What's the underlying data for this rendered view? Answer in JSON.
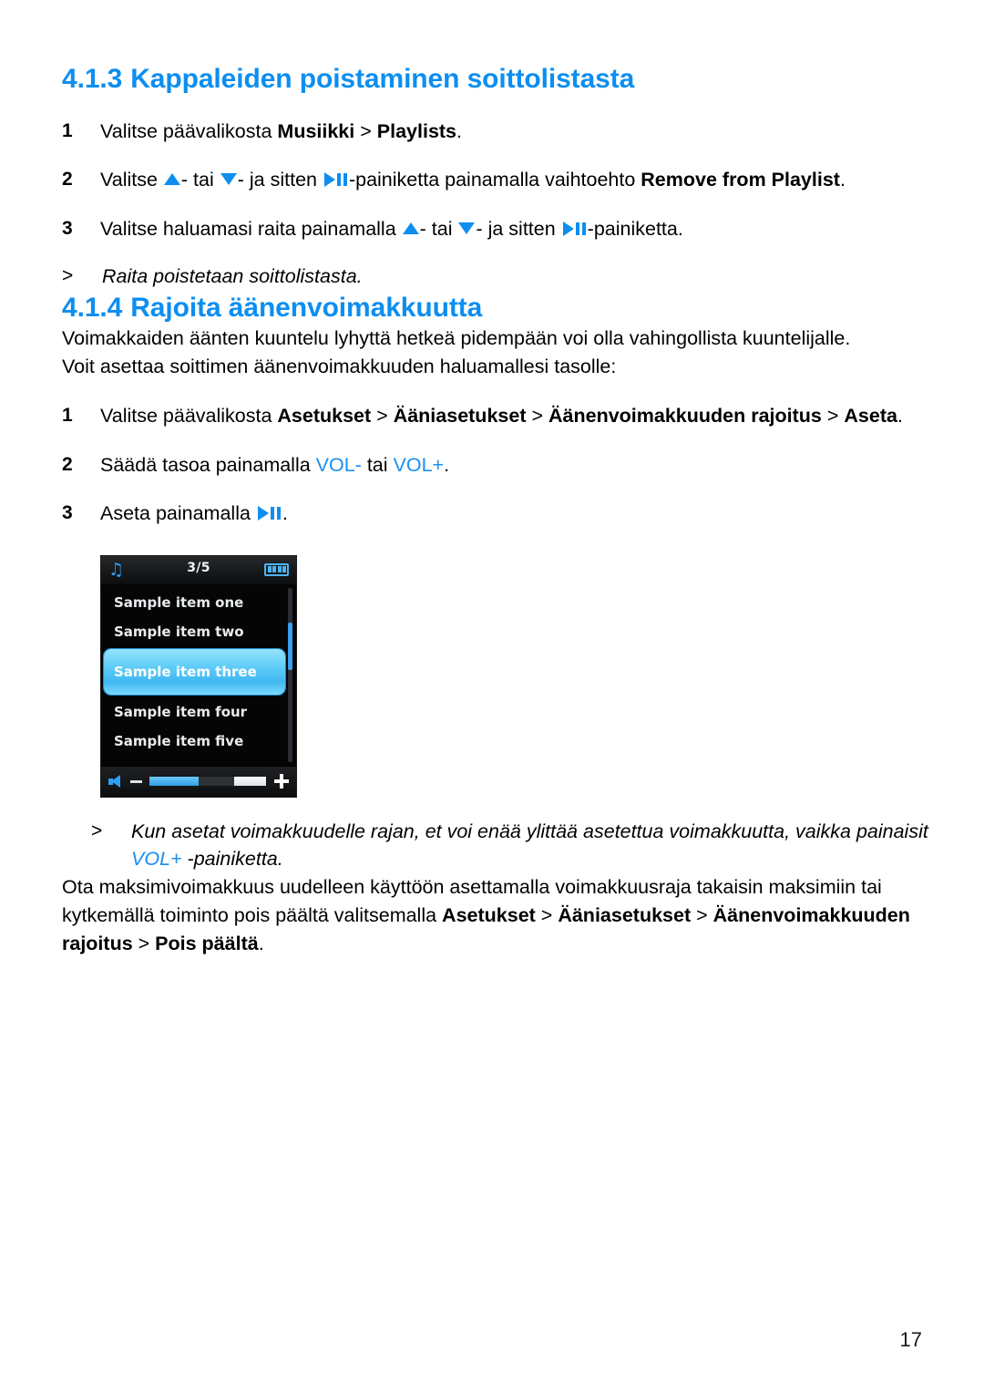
{
  "document": {
    "page_number": "17",
    "accent_color": "#0d8ef0",
    "text_color": "#000000"
  },
  "sections": [
    {
      "number": "4.1.3",
      "title": "Kappaleiden poistaminen soittolistasta"
    },
    {
      "number": "4.1.4",
      "title": "Rajoita äänenvoimakkuutta"
    }
  ],
  "steps_group_1": [
    {
      "num": "1",
      "parts": [
        {
          "type": "text",
          "text": "Valitse päävalikosta "
        },
        {
          "type": "bold",
          "text": "Musiikki"
        },
        {
          "type": "text",
          "text": " > "
        },
        {
          "type": "bold",
          "text": "Playlists"
        },
        {
          "type": "text",
          "text": "."
        }
      ]
    },
    {
      "num": "2",
      "parts": [
        {
          "type": "text",
          "text": "Valitse "
        },
        {
          "type": "icon",
          "icon": "triangle-up-icon"
        },
        {
          "type": "text",
          "text": "- tai "
        },
        {
          "type": "icon",
          "icon": "triangle-down-icon"
        },
        {
          "type": "text",
          "text": "- ja sitten "
        },
        {
          "type": "icon",
          "icon": "play-pause-icon"
        },
        {
          "type": "text",
          "text": "-painiketta painamalla vaihtoehto "
        },
        {
          "type": "bold",
          "text": "Remove from Playlist"
        },
        {
          "type": "text",
          "text": "."
        }
      ]
    },
    {
      "num": "3",
      "parts": [
        {
          "type": "text",
          "text": "Valitse haluamasi raita painamalla "
        },
        {
          "type": "icon",
          "icon": "triangle-up-icon"
        },
        {
          "type": "text",
          "text": "- tai "
        },
        {
          "type": "icon",
          "icon": "triangle-down-icon"
        },
        {
          "type": "text",
          "text": "- ja sitten "
        },
        {
          "type": "icon",
          "icon": "play-pause-icon"
        },
        {
          "type": "text",
          "text": "-painiketta."
        }
      ]
    }
  ],
  "note_1": {
    "caret": ">",
    "text": "Raita poistetaan soittolistasta."
  },
  "intro_paragraph": {
    "line_1": "Voimakkaiden äänten kuuntelu lyhyttä hetkeä pidempään voi olla vahingollista kuuntelijalle.",
    "line_2": "Voit asettaa soittimen äänenvoimakkuuden haluamallesi tasolle:"
  },
  "steps_group_2": [
    {
      "num": "1",
      "parts": [
        {
          "type": "text",
          "text": "Valitse päävalikosta "
        },
        {
          "type": "bold",
          "text": "Asetukset"
        },
        {
          "type": "text",
          "text": " > "
        },
        {
          "type": "bold",
          "text": "Ääniasetukset"
        },
        {
          "type": "text",
          "text": " > "
        },
        {
          "type": "bold",
          "text": "Äänenvoimakkuuden rajoitus"
        },
        {
          "type": "text",
          "text": " > "
        },
        {
          "type": "bold",
          "text": "Aseta"
        },
        {
          "type": "text",
          "text": "."
        }
      ]
    },
    {
      "num": "2",
      "parts": [
        {
          "type": "text",
          "text": "Säädä tasoa painamalla "
        },
        {
          "type": "accent",
          "text": "VOL-"
        },
        {
          "type": "text",
          "text": " tai "
        },
        {
          "type": "accent",
          "text": "VOL+"
        },
        {
          "type": "text",
          "text": "."
        }
      ]
    },
    {
      "num": "3",
      "parts": [
        {
          "type": "text",
          "text": "Aseta painamalla "
        },
        {
          "type": "icon",
          "icon": "play-pause-icon"
        },
        {
          "type": "text",
          "text": "."
        }
      ]
    }
  ],
  "device": {
    "status": {
      "music_icon": "music-note-icon",
      "track_counter": "3/5",
      "battery_icon": "battery-full-icon",
      "battery_bars": 4
    },
    "list_items": [
      {
        "label": "Sample item one",
        "selected": false
      },
      {
        "label": "Sample item two",
        "selected": false
      },
      {
        "label": "Sample item three",
        "selected": true
      },
      {
        "label": "Sample item four",
        "selected": false
      },
      {
        "label": "Sample item five",
        "selected": false
      }
    ],
    "volume": {
      "speaker_icon": "speaker-icon",
      "minus_icon": "minus-icon",
      "plus_icon": "plus-icon",
      "fill_percent": 42,
      "cap_start_percent": 73,
      "track_color": "#2e3236",
      "fill_color": "#2f9fe8"
    },
    "scrollbar": {
      "thumb_color": "#3a9ff0"
    }
  },
  "note_2": {
    "caret": ">",
    "line_1": "Kun asetat voimakkuudelle rajan, et voi enää ylittää asetettua voimakkuutta, vaikka painaisit",
    "accent_text": "VOL+",
    "line_2_tail": " -painiketta."
  },
  "outro_paragraph": {
    "parts": [
      {
        "type": "text",
        "text": "Ota maksimivoimakkuus uudelleen käyttöön asettamalla voimakkuusraja takaisin maksimiin tai kytkemällä toiminto pois päältä valitsemalla "
      },
      {
        "type": "bold",
        "text": "Asetukset"
      },
      {
        "type": "text",
        "text": " > "
      },
      {
        "type": "bold",
        "text": "Ääniasetukset"
      },
      {
        "type": "text",
        "text": " > "
      },
      {
        "type": "bold",
        "text": "Äänenvoimakkuuden rajoitus"
      },
      {
        "type": "text",
        "text": " > "
      },
      {
        "type": "bold",
        "text": "Pois päältä"
      },
      {
        "type": "text",
        "text": "."
      }
    ]
  }
}
